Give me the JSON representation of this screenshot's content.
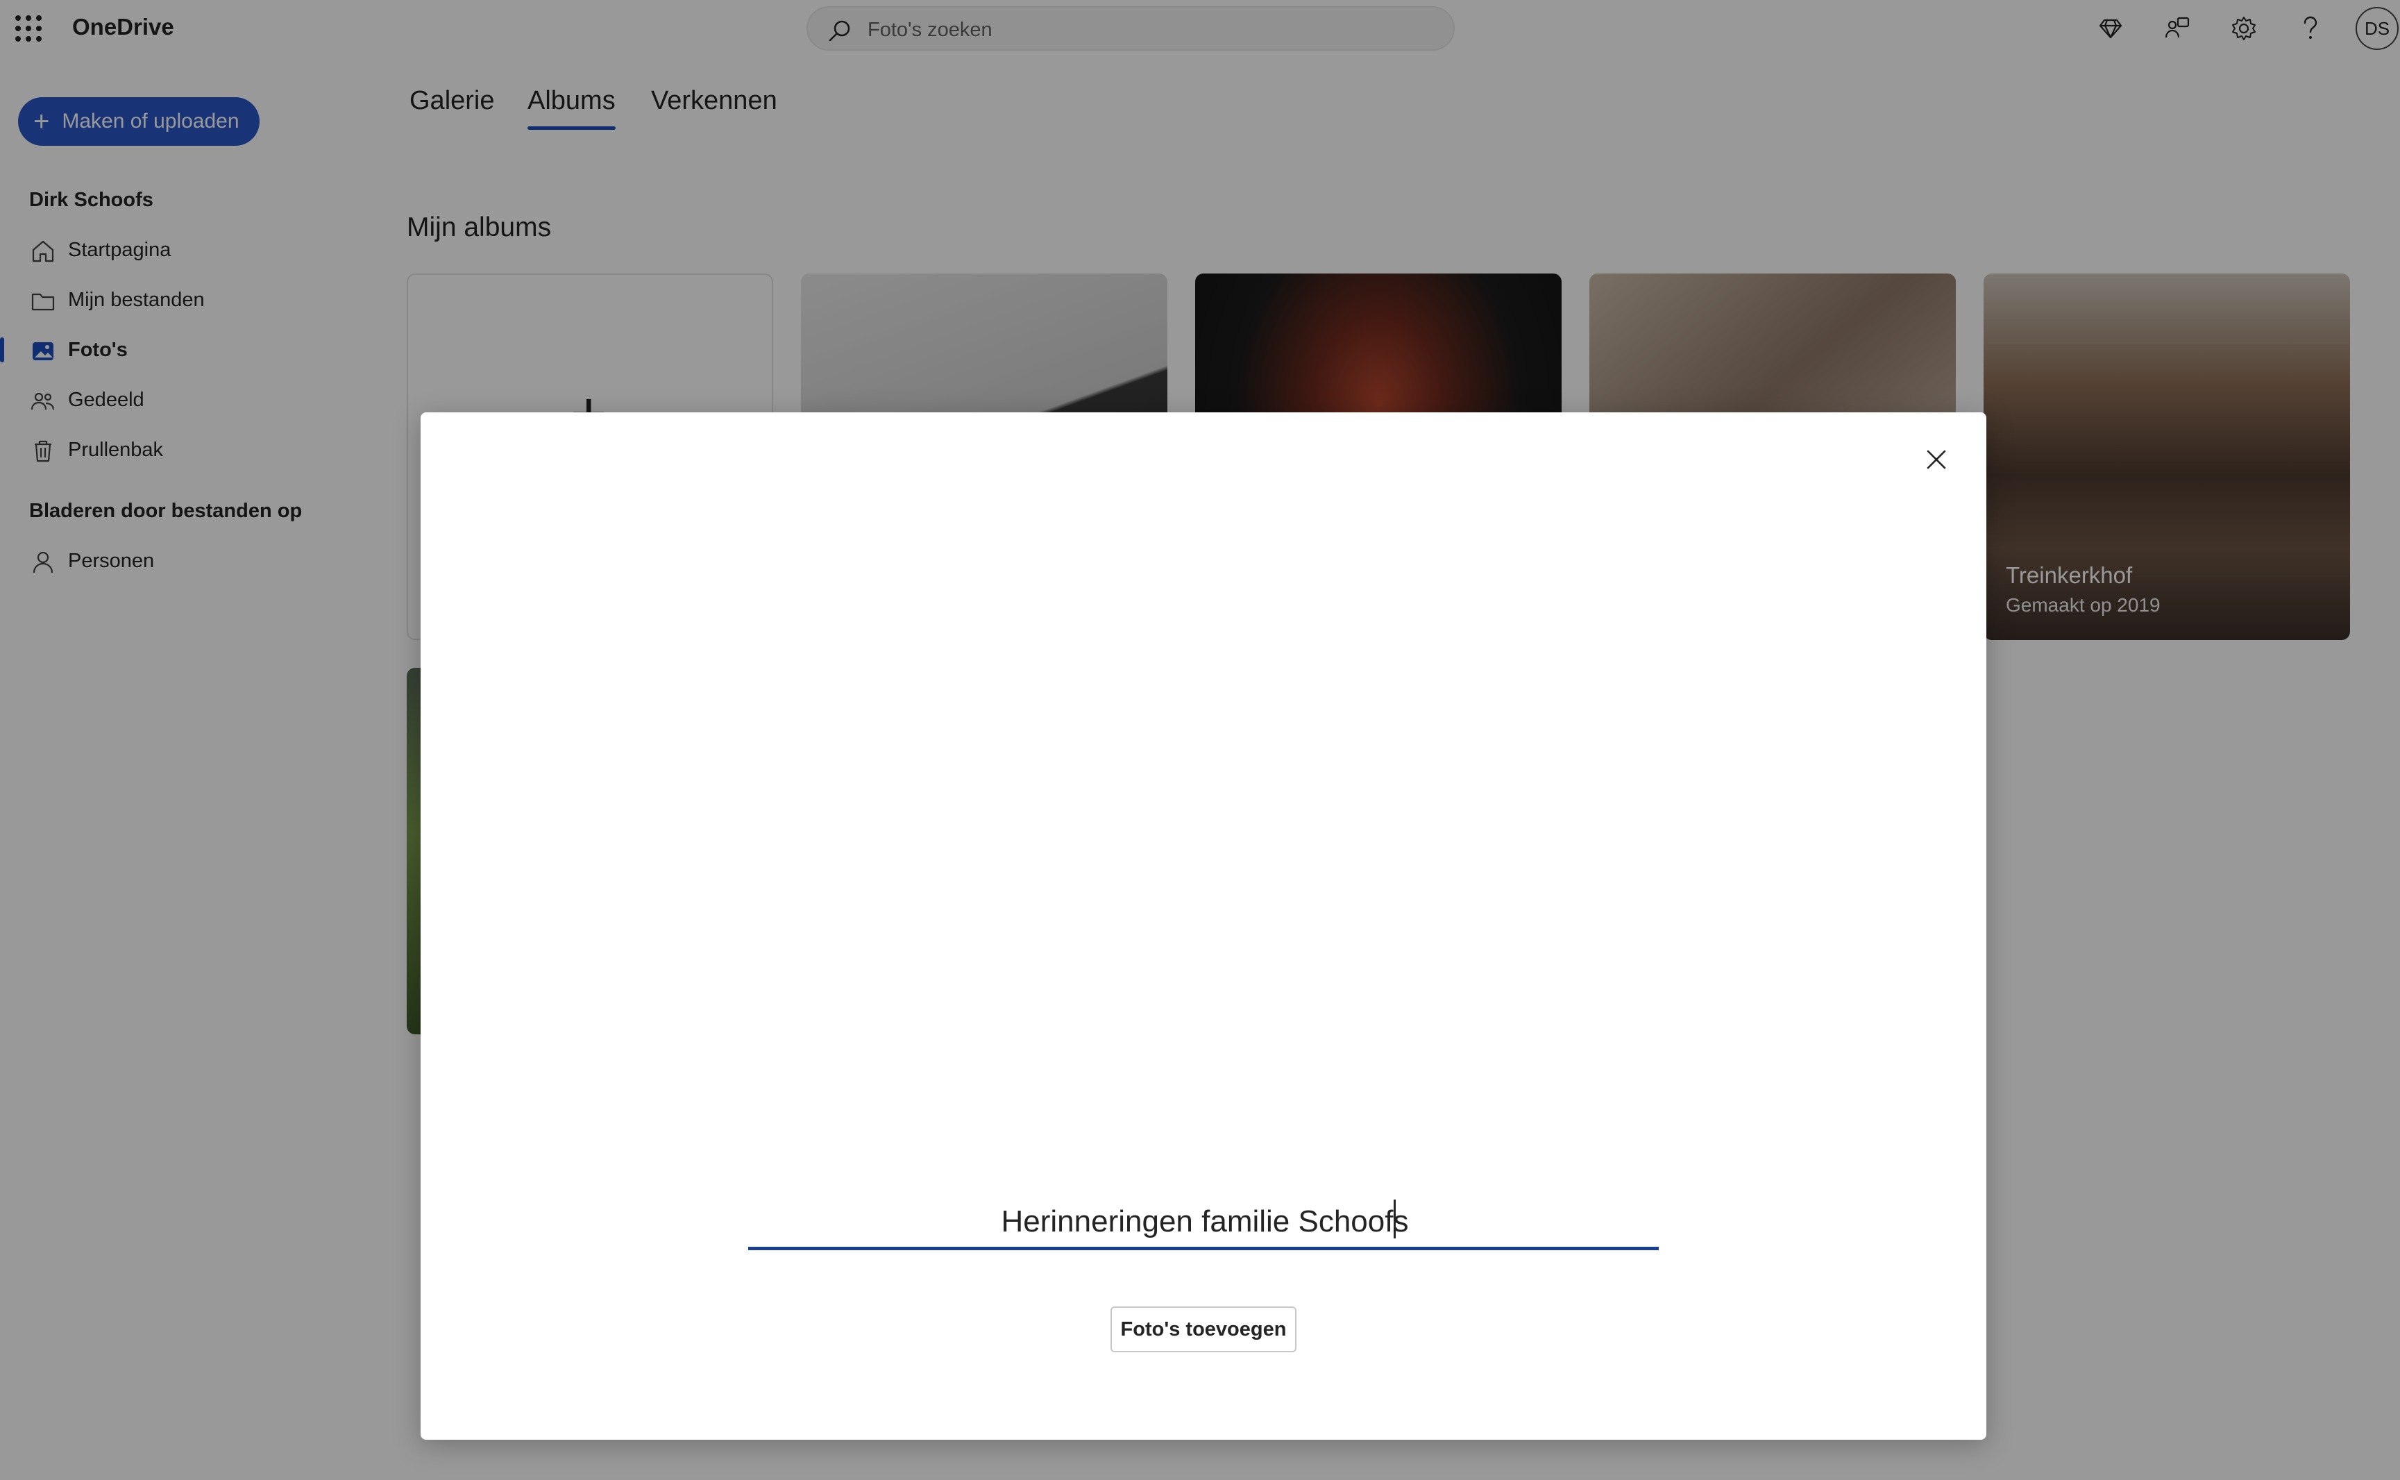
{
  "app": {
    "title": "OneDrive"
  },
  "search": {
    "placeholder": "Foto's zoeken"
  },
  "header_icons": [
    "premium-diamond-icon",
    "share-icon",
    "settings-gear-icon",
    "help-icon"
  ],
  "user": {
    "initials": "DS"
  },
  "sidebar": {
    "create_label": "Maken of uploaden",
    "user_name": "Dirk Schoofs",
    "items": [
      {
        "label": "Startpagina",
        "icon": "home-icon"
      },
      {
        "label": "Mijn bestanden",
        "icon": "folder-icon"
      },
      {
        "label": "Foto's",
        "icon": "photos-icon",
        "active": true
      },
      {
        "label": "Gedeeld",
        "icon": "shared-people-icon"
      },
      {
        "label": "Prullenbak",
        "icon": "trash-icon"
      }
    ],
    "browse_heading": "Bladeren door bestanden op",
    "browse_items": [
      {
        "label": "Personen",
        "icon": "person-icon"
      }
    ]
  },
  "tabs": [
    {
      "label": "Galerie"
    },
    {
      "label": "Albums",
      "selected": true
    },
    {
      "label": "Verkennen"
    }
  ],
  "main": {
    "section_title": "Mijn albums",
    "albums": [
      {
        "title": "Treinkerkhof",
        "subtitle": "Gemaakt op 2019"
      }
    ]
  },
  "dialog": {
    "album_name_value": "Herinneringen familie Schoofs",
    "add_photos_label": "Foto's toevoegen"
  },
  "colors": {
    "accent": "#1a4fbf",
    "create_button": "#2b55c7",
    "overlay": "rgba(0,0,0,0.4)"
  }
}
